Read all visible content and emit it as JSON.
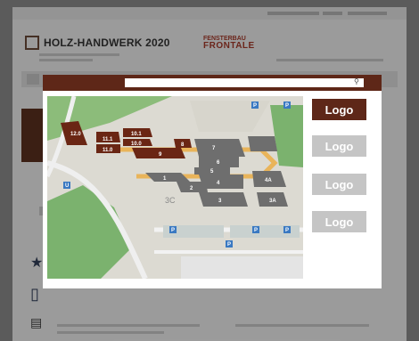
{
  "header": {
    "brand_name": "HOLZ-HANDWERK 2020",
    "partner_line1": "FENSTERBAU",
    "partner_line2": "FRONTALE"
  },
  "modal": {
    "search_placeholder": "",
    "search_icon": "search-icon",
    "logos": [
      {
        "label": "Logo",
        "state": "active"
      },
      {
        "label": "Logo",
        "state": "inactive"
      },
      {
        "label": "Logo",
        "state": "inactive"
      },
      {
        "label": "Logo",
        "state": "inactive"
      }
    ]
  },
  "map": {
    "halls_highlighted": [
      "12.0",
      "11.1",
      "11.0",
      "10.1",
      "10.0",
      "9",
      "8"
    ],
    "halls_other": [
      "7",
      "6",
      "5",
      "4",
      "4A",
      "3",
      "3A",
      "2",
      "1",
      "3C"
    ],
    "parking_labels": [
      "P",
      "P",
      "P",
      "P",
      "P",
      "P"
    ],
    "station_labels": [
      "U"
    ],
    "note_3C": "3C",
    "colors": {
      "highlight": "#6a2614",
      "hall": "#6e6e6e",
      "grass": "#7bb26e",
      "path": "#e9b45a"
    }
  },
  "colors": {
    "accent": "#5e2718",
    "inactive": "#c5c5c5"
  }
}
